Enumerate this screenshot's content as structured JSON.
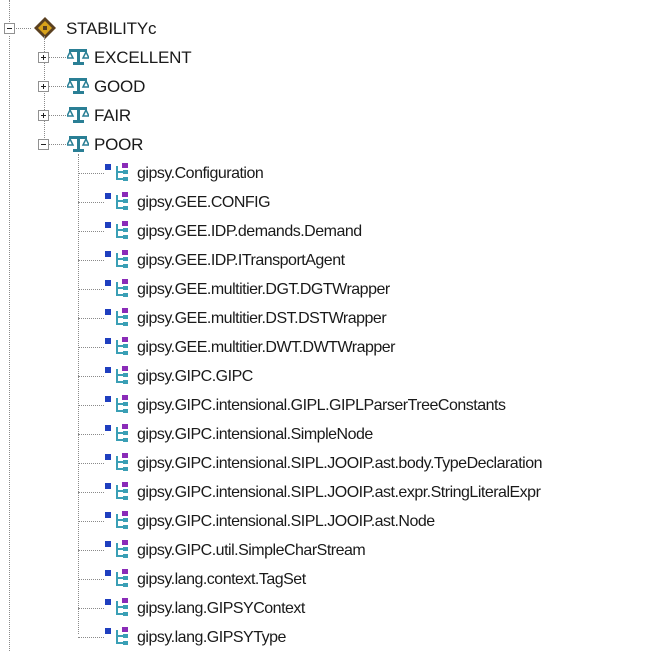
{
  "tree": {
    "root": {
      "label": "STABILITYc",
      "icon": "stability-diamond-icon",
      "expanded": true
    },
    "categories": [
      {
        "label": "EXCELLENT",
        "icon": "scale-icon",
        "expanded": false
      },
      {
        "label": "GOOD",
        "icon": "scale-icon",
        "expanded": false
      },
      {
        "label": "FAIR",
        "icon": "scale-icon",
        "expanded": false
      },
      {
        "label": "POOR",
        "icon": "scale-icon",
        "expanded": true
      }
    ],
    "poor_items": [
      "gipsy.Configuration",
      "gipsy.GEE.CONFIG",
      "gipsy.GEE.IDP.demands.Demand",
      "gipsy.GEE.IDP.ITransportAgent",
      "gipsy.GEE.multitier.DGT.DGTWrapper",
      "gipsy.GEE.multitier.DST.DSTWrapper",
      "gipsy.GEE.multitier.DWT.DWTWrapper",
      "gipsy.GIPC.GIPC",
      "gipsy.GIPC.intensional.GIPL.GIPLParserTreeConstants",
      "gipsy.GIPC.intensional.SimpleNode",
      "gipsy.GIPC.intensional.SIPL.JOOIP.ast.body.TypeDeclaration",
      "gipsy.GIPC.intensional.SIPL.JOOIP.ast.expr.StringLiteralExpr",
      "gipsy.GIPC.intensional.SIPL.JOOIP.ast.Node",
      "gipsy.GIPC.util.SimpleCharStream",
      "gipsy.lang.context.TagSet",
      "gipsy.lang.GIPSYContext",
      "gipsy.lang.GIPSYType"
    ],
    "colors": {
      "scale_icon": "#2a7f95",
      "class_square": "#1f3fbf",
      "class_square_accent": "#8a2bb8",
      "class_tree": "#3a9fb5",
      "root_diamond": "#5a4020",
      "root_diamond_accent": "#d9a21a"
    }
  }
}
